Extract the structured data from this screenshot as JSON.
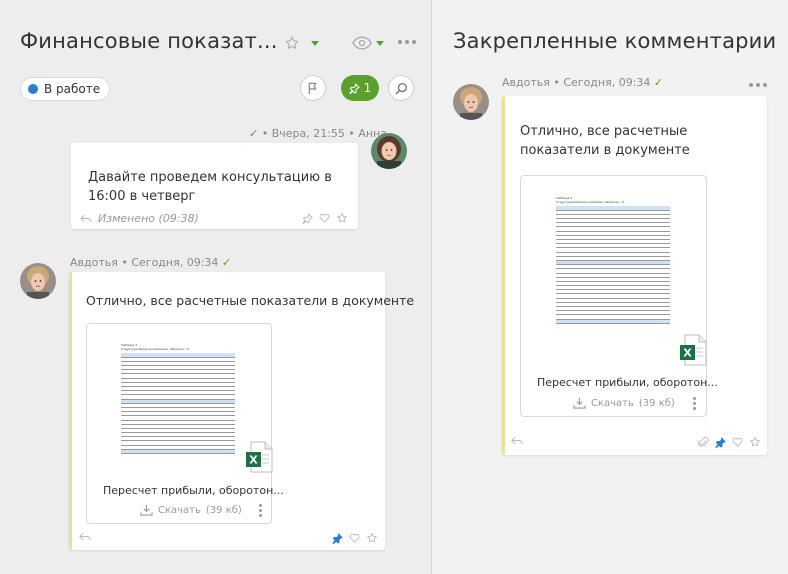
{
  "left": {
    "title": "Финансовые показат...",
    "status_label": "В работе",
    "pin_count": "1",
    "comment1": {
      "time": "Вчера, 21:55",
      "author": "Анна",
      "text": "Давайте проведем консультацию в 16:00 в четверг",
      "edited": "Изменено (09:38)"
    },
    "comment2": {
      "author": "Авдотья",
      "time": "Сегодня, 09:34",
      "text": "Отлично, все расчетные показатели в документе",
      "attachment": {
        "name": "Пересчет прибыли, оборотон...",
        "download_label": "Скачать",
        "size": "(39 кб)"
      }
    }
  },
  "right": {
    "title": "Закрепленные комментарии",
    "comment": {
      "author": "Авдотья",
      "time": "Сегодня, 09:34",
      "text": "Отлично, все расчетные показатели в документе",
      "attachment": {
        "name": "Пересчет прибыли, оборотон...",
        "download_label": "Скачать",
        "size": "(39 кб)"
      }
    }
  },
  "colors": {
    "accent_green": "#5aa02c",
    "status_blue": "#2a7dd1",
    "pin_blue": "#2a7dd1",
    "card_accent": "#e9e48f"
  },
  "icons": [
    "star-icon",
    "eye-icon",
    "more-icon",
    "flag-icon",
    "pin-icon",
    "search-icon",
    "reply-icon",
    "heart-icon",
    "paperclip-icon",
    "download-icon",
    "excel-icon"
  ]
}
